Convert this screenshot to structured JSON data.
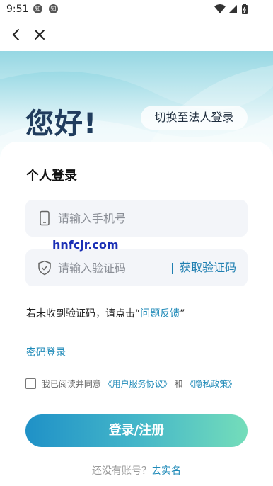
{
  "status": {
    "time": "9:51",
    "notif_1": "知",
    "notif_2": "知"
  },
  "header": {
    "greeting": "您好!",
    "switch_label": "切换至法人登录"
  },
  "form": {
    "title": "个人登录",
    "phone_placeholder": "请输入手机号",
    "code_placeholder": "请输入验证码",
    "get_code_label": "获取验证码",
    "watermark": "hnfcjr.com",
    "hint_prefix": "若未收到验证码，请点击“",
    "hint_link": "问题反馈",
    "hint_suffix": "”",
    "password_login": "密码登录",
    "agree_prefix": "我已阅读并同意",
    "user_agreement": "《用户服务协议》",
    "and": "和",
    "privacy_policy": "《隐私政策》",
    "login_button": "登录/注册",
    "register_prompt": "还没有账号？",
    "register_link": "去实名"
  },
  "colors": {
    "accent": "#1f8ab8",
    "title": "#213d5e"
  },
  "icons": [
    "back-arrow-icon",
    "close-icon",
    "phone-icon",
    "shield-check-icon",
    "wifi-icon",
    "battery-icon",
    "signal-icon"
  ]
}
